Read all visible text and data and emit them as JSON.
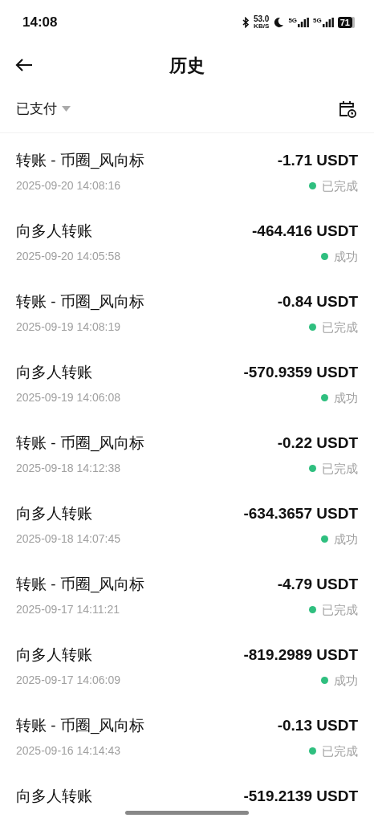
{
  "status_bar": {
    "time": "14:08",
    "speed": "53.0",
    "speed_unit": "KB/S",
    "network_1": "5G",
    "network_2": "5G",
    "battery": "71"
  },
  "header": {
    "title": "历史"
  },
  "filter": {
    "label": "已支付"
  },
  "transactions": [
    {
      "title": "转账 - 币圈_风向标",
      "date": "2025-09-20 14:08:16",
      "amount": "-1.71 USDT",
      "status": "已完成"
    },
    {
      "title": "向多人转账",
      "date": "2025-09-20 14:05:58",
      "amount": "-464.416 USDT",
      "status": "成功"
    },
    {
      "title": "转账 - 币圈_风向标",
      "date": "2025-09-19 14:08:19",
      "amount": "-0.84 USDT",
      "status": "已完成"
    },
    {
      "title": "向多人转账",
      "date": "2025-09-19 14:06:08",
      "amount": "-570.9359 USDT",
      "status": "成功"
    },
    {
      "title": "转账 - 币圈_风向标",
      "date": "2025-09-18 14:12:38",
      "amount": "-0.22 USDT",
      "status": "已完成"
    },
    {
      "title": "向多人转账",
      "date": "2025-09-18 14:07:45",
      "amount": "-634.3657 USDT",
      "status": "成功"
    },
    {
      "title": "转账 - 币圈_风向标",
      "date": "2025-09-17 14:11:21",
      "amount": "-4.79 USDT",
      "status": "已完成"
    },
    {
      "title": "向多人转账",
      "date": "2025-09-17 14:06:09",
      "amount": "-819.2989 USDT",
      "status": "成功"
    },
    {
      "title": "转账 - 币圈_风向标",
      "date": "2025-09-16 14:14:43",
      "amount": "-0.13 USDT",
      "status": "已完成"
    },
    {
      "title": "向多人转账",
      "amount": "-519.2139 USDT"
    }
  ]
}
